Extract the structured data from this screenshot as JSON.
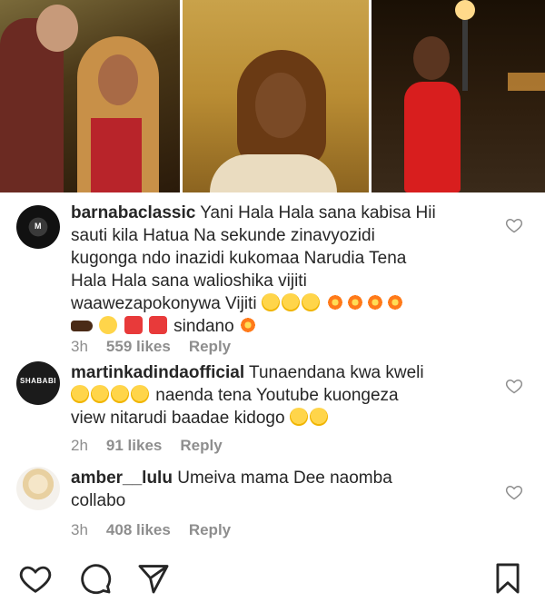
{
  "post": {
    "photos": [
      "photo-1",
      "photo-2",
      "photo-3"
    ]
  },
  "comments": [
    {
      "username": "barnabaclassic",
      "text_lines": [
        "Yani Hala Hala sana kabisa Hii",
        "sauti kila Hatua Na sekunde zinavyozidi",
        "kugonga ndo inazidi kukomaa Narudia Tena",
        "Hala Hala sana walioshika vijiti",
        "waawezapokonywa Vijiti",
        "sindano"
      ],
      "time": "3h",
      "likes": "559 likes",
      "reply": "Reply"
    },
    {
      "username": "martinkadindaofficial",
      "avatar_text": "SHABABI",
      "text_lines": [
        "Tunaendana kwa kweli",
        "naenda tena Youtube kuongeza",
        "view nitarudi baadae kidogo"
      ],
      "time": "2h",
      "likes": "91 likes",
      "reply": "Reply"
    },
    {
      "username": "amber__lulu",
      "text_lines": [
        "Umeiva mama Dee naomba",
        "collabo"
      ],
      "time": "3h",
      "likes": "408 likes",
      "reply": "Reply"
    }
  ],
  "action_bar": {
    "icons": [
      "heart-icon",
      "comment-icon",
      "share-icon",
      "bookmark-icon"
    ]
  },
  "colors": {
    "text": "#262626",
    "meta": "#8e8e8e"
  }
}
